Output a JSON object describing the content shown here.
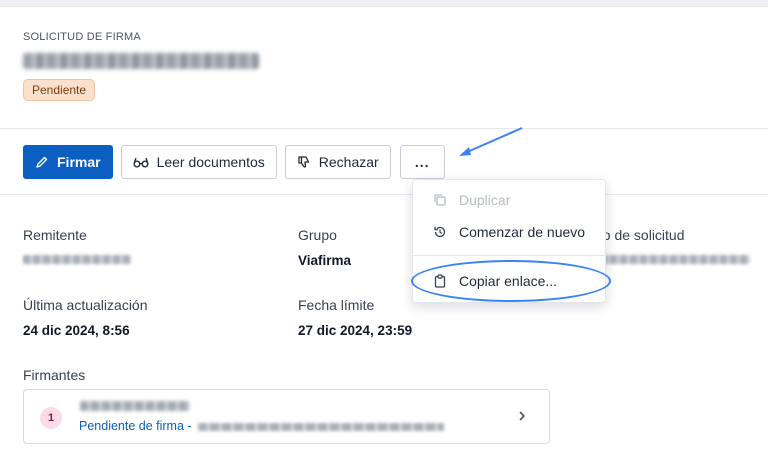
{
  "header": {
    "eyebrow": "SOLICITUD DE FIRMA",
    "status_badge": "Pendiente"
  },
  "toolbar": {
    "sign_label": "Firmar",
    "read_label": "Leer documentos",
    "reject_label": "Rechazar",
    "more_label": "..."
  },
  "menu": {
    "items": [
      {
        "label": "Duplicar",
        "icon": "copy-icon",
        "disabled": true
      },
      {
        "label": "Comenzar de nuevo",
        "icon": "restart-icon",
        "disabled": false
      },
      {
        "label": "Copiar enlace...",
        "icon": "clipboard-icon",
        "disabled": false
      }
    ]
  },
  "fields": {
    "sender_label": "Remitente",
    "group_label": "Grupo",
    "group_value": "Viafirma",
    "request_code_label": "go de solicitud",
    "updated_label": "Última actualización",
    "updated_value": "24 dic 2024, 8:56",
    "deadline_label": "Fecha límite",
    "deadline_value": "27 dic 2024, 23:59"
  },
  "signers": {
    "label": "Firmantes",
    "items": [
      {
        "number": "1",
        "status": "Pendiente de firma -"
      }
    ]
  },
  "colors": {
    "primary": "#0a5fc0",
    "badge_bg": "#fbe1cd",
    "annotation": "#3b82f6"
  }
}
